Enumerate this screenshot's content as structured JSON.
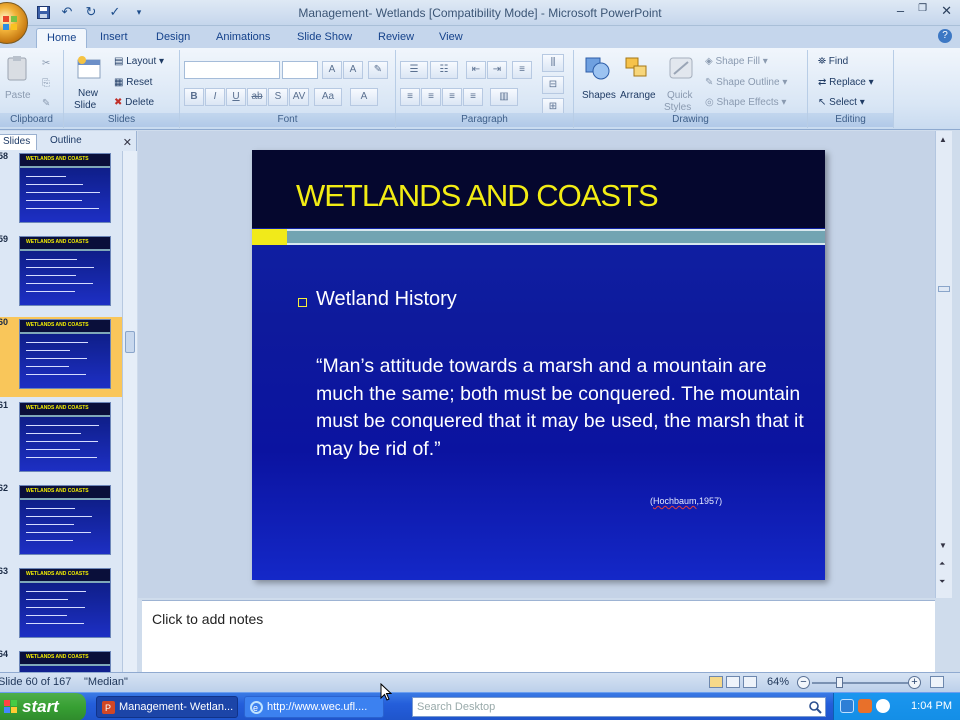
{
  "window": {
    "title": "Management- Wetlands [Compatibility Mode] - Microsoft PowerPoint"
  },
  "ribbon_tabs": [
    "Home",
    "Insert",
    "Design",
    "Animations",
    "Slide Show",
    "Review",
    "View"
  ],
  "ribbon": {
    "clipboard": {
      "paste": "Paste",
      "label": "Clipboard"
    },
    "slides": {
      "new_slide_1": "New",
      "new_slide_2": "Slide",
      "layout": "Layout",
      "reset": "Reset",
      "delete": "Delete",
      "label": "Slides"
    },
    "font": {
      "label": "Font"
    },
    "paragraph": {
      "label": "Paragraph"
    },
    "drawing": {
      "shapes": "Shapes",
      "arrange": "Arrange",
      "quick_styles_1": "Quick",
      "quick_styles_2": "Styles",
      "shape_fill": "Shape Fill",
      "shape_outline": "Shape Outline",
      "shape_effects": "Shape Effects",
      "label": "Drawing"
    },
    "editing": {
      "find": "Find",
      "replace": "Replace",
      "select": "Select",
      "label": "Editing"
    }
  },
  "left_pane": {
    "tabs": [
      "Slides",
      "Outline"
    ],
    "thumbnails": [
      {
        "number": "58",
        "title": "WETLANDS AND COASTS"
      },
      {
        "number": "59",
        "title": "WETLANDS AND COASTS"
      },
      {
        "number": "60",
        "title": "WETLANDS AND COASTS"
      },
      {
        "number": "61",
        "title": "WETLANDS AND COASTS"
      },
      {
        "number": "62",
        "title": "WETLANDS AND COASTS"
      },
      {
        "number": "63",
        "title": "WETLANDS AND COASTS"
      },
      {
        "number": "64",
        "title": "WETLANDS AND COASTS"
      }
    ],
    "selected_index": 2
  },
  "slide": {
    "title": "WETLANDS AND COASTS",
    "bullet": "Wetland History",
    "quote": "“Man’s attitude towards a marsh and a mountain are much the same; both must be conquered.  The mountain must be conquered that it may be used, the marsh that it may be rid of.”",
    "citation_name": "Hochbaum",
    "citation_year": "1957)",
    "citation_open": "(",
    "colors": {
      "title": "#f2ec14",
      "background": "#1125a8",
      "accent_bar": "#72a4b2"
    }
  },
  "notes": {
    "placeholder": "Click to add notes"
  },
  "status": {
    "slide_info": "Slide 60 of 167",
    "theme": "\"Median\"",
    "zoom": "64%"
  },
  "taskbar": {
    "start": "start",
    "tasks": [
      "Management- Wetlan...",
      "http://www.wec.ufl...."
    ],
    "search_placeholder": "Search Desktop",
    "clock": "1:04 PM"
  }
}
